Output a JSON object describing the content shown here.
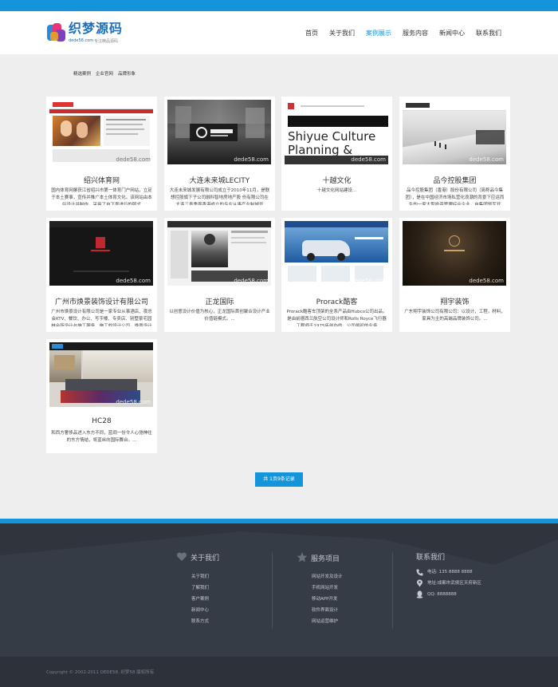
{
  "brand": {
    "logo_text": "织梦源码",
    "logo_sub": "dede58.com",
    "logo_tagline": "专注精品源码",
    "colors": {
      "accent": "#1595d9",
      "footer": "#363c46",
      "copyright_bar": "#2d323a"
    }
  },
  "nav": {
    "items": [
      {
        "label": "首页"
      },
      {
        "label": "关于我们"
      },
      {
        "label": "案例展示",
        "active": true
      },
      {
        "label": "服务内容"
      },
      {
        "label": "新闻中心"
      },
      {
        "label": "联系我们"
      }
    ]
  },
  "subnav": {
    "items": [
      "精选案例",
      "企业官网",
      "品牌形象"
    ]
  },
  "cases": [
    {
      "title": "绍兴体育网",
      "desc": "国内体育网屡获江省绍兴市第一体育门户网站，立足于本土赛事，宣传并推广本土体育文化。该网站由本站设计并制作，采用了自下景进行的版式",
      "watermark": "dede58.com"
    },
    {
      "title": "大连未来城LECITY",
      "desc": "大连未来城发展有限公司成立于2010年11月，是联想控股旗下子公司融科智地房地产股 份有限公司在大连三青重面香港成立的专业从事产业制城开",
      "watermark": "dede58.com"
    },
    {
      "title": "十越文化",
      "desc": "十越文化网站建设...",
      "watermark": "dede58.com",
      "banner_text": "Shiyue Culture Planning & Design"
    },
    {
      "title": "品今控股集团",
      "desc": "品今控股集团（香港）股份有限公司（简称品今集团），是在中国经济市场私营化浪潮的背景下应运而生的一家大型投资管理综合企业，自集团领军开",
      "watermark": "dede58.com"
    },
    {
      "title": "广州市焕景装饰设计有限公司",
      "desc": "广州市焕景设计有限公司是一家专业从事酒店、夜总会KTV、餐饮、办公、写字楼、专卖店、别墅豪宅园林会所设计与施工服务、施工的设计公司，焕景设计公司是广",
      "watermark": "dede58.com"
    },
    {
      "title": "正龙国际",
      "desc": "以创意设计价值为核心，正龙国际首创聚合设计产业价值链模式。...",
      "watermark": "dede58.com"
    },
    {
      "title": "Prorack酷客",
      "desc": "Prorack酷客车顶架的全系产品由Hubco公司出品，是由前德西兰航空公司设计师和Rolls Royce飞行器工程师于1975年创办的，公司最初的业务",
      "watermark": "dede58.com"
    },
    {
      "title": "翔宇装饰",
      "desc": "广东翔宇装饰公司有限公司：以设计，工程，材料，家具为主的高端品牌装饰公司。...",
      "watermark": "dede58.com"
    },
    {
      "title": "HC28",
      "desc": "和西方奢侈品进入东方不同，蓝绸一份令人心驰神往的东方情结，将蓝丝向国际舞台。...",
      "watermark": "dede58.com"
    }
  ],
  "pager": {
    "label": "共 1页9条记录"
  },
  "footer": {
    "about": {
      "heading": "关于我们",
      "links": [
        "关于我们",
        "了解我们",
        "客户案例",
        "新闻中心",
        "联系方式"
      ]
    },
    "services": {
      "heading": "服务项目",
      "links": [
        "网站开发及设计",
        "手机网站开发",
        "移动APP开发",
        "软件界面设计",
        "网站运营维护"
      ]
    },
    "contact": {
      "heading": "联系我们",
      "phone": "电话: 135 8888 8888",
      "address": "地址:成都市武侯区天府新区",
      "qq": "QQ: 8888888"
    },
    "copyright": "Copyright © 2002-2011 DEDE58. 织梦58 版权所有"
  }
}
